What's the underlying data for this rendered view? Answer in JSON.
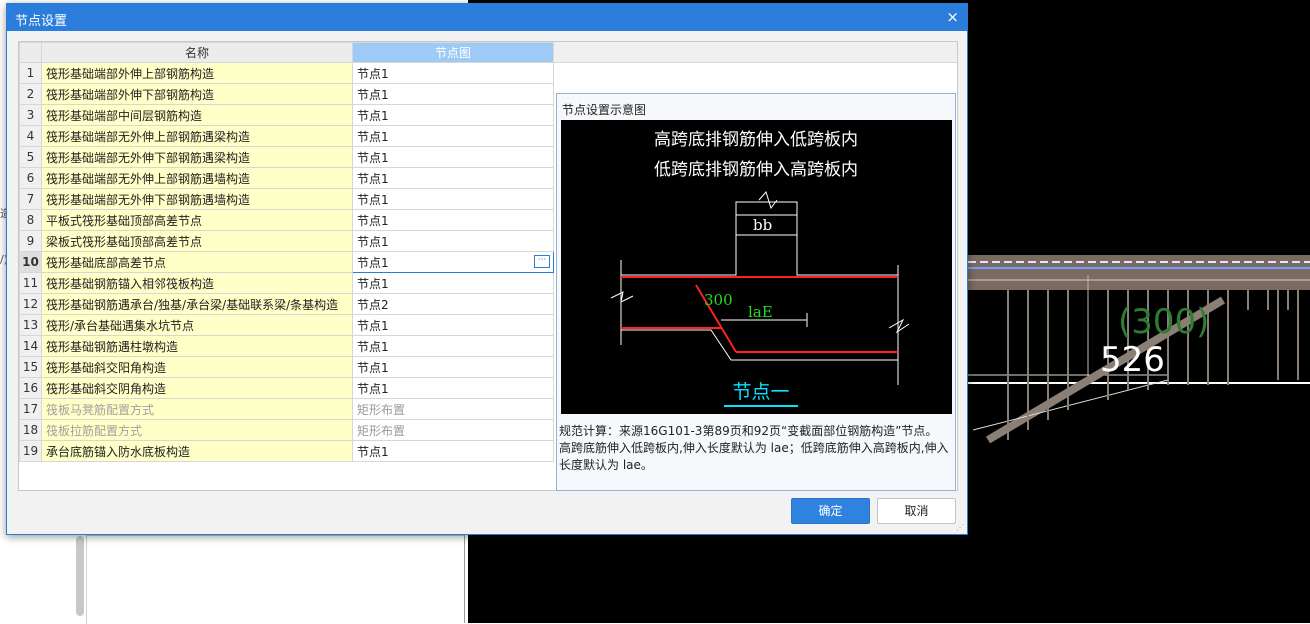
{
  "dialog": {
    "title": "节点设置",
    "close_label": "×",
    "ok_label": "确定",
    "cancel_label": "取消"
  },
  "table": {
    "columns": [
      "名称",
      "节点图"
    ],
    "rows": [
      {
        "num": "1",
        "name": "筏形基础端部外伸上部钢筋构造",
        "node": "节点1"
      },
      {
        "num": "2",
        "name": "筏形基础端部外伸下部钢筋构造",
        "node": "节点1"
      },
      {
        "num": "3",
        "name": "筏形基础端部中间层钢筋构造",
        "node": "节点1"
      },
      {
        "num": "4",
        "name": "筏形基础端部无外伸上部钢筋遇梁构造",
        "node": "节点1"
      },
      {
        "num": "5",
        "name": "筏形基础端部无外伸下部钢筋遇梁构造",
        "node": "节点1"
      },
      {
        "num": "6",
        "name": "筏形基础端部无外伸上部钢筋遇墙构造",
        "node": "节点1"
      },
      {
        "num": "7",
        "name": "筏形基础端部无外伸下部钢筋遇墙构造",
        "node": "节点1"
      },
      {
        "num": "8",
        "name": "平板式筏形基础顶部高差节点",
        "node": "节点1"
      },
      {
        "num": "9",
        "name": "梁板式筏形基础顶部高差节点",
        "node": "节点1"
      },
      {
        "num": "10",
        "name": "筏形基础底部高差节点",
        "node": "节点1"
      },
      {
        "num": "11",
        "name": "筏形基础钢筋锚入相邻筏板构造",
        "node": "节点1"
      },
      {
        "num": "12",
        "name": "筏形基础钢筋遇承台/独基/承台梁/基础联系梁/条基构造",
        "node": "节点2"
      },
      {
        "num": "13",
        "name": "筏形/承台基础遇集水坑节点",
        "node": "节点1"
      },
      {
        "num": "14",
        "name": "筏形基础钢筋遇柱墩构造",
        "node": "节点1"
      },
      {
        "num": "15",
        "name": "筏形基础斜交阳角构造",
        "node": "节点1"
      },
      {
        "num": "16",
        "name": "筏形基础斜交阴角构造",
        "node": "节点1"
      },
      {
        "num": "17",
        "name": "筏板马凳筋配置方式",
        "node": "矩形布置"
      },
      {
        "num": "18",
        "name": "筏板拉筋配置方式",
        "node": "矩形布置"
      },
      {
        "num": "19",
        "name": "承台底筋锚入防水底板构造",
        "node": "节点1"
      }
    ],
    "selected_row": "10",
    "disabled_rows": [
      "17",
      "18"
    ]
  },
  "preview": {
    "title": "节点设置示意图",
    "diagram_line1": "高跨底排钢筋伸入低跨板内",
    "diagram_line2": "低跨底排钢筋伸入高跨板内",
    "label_bb": "bb",
    "label_300": "300",
    "label_lae": "laE",
    "label_node": "节点一",
    "description": "规范计算：来源16G101-3第89页和92页“变截面部位钢筋构造”节点。\n高跨底筋伸入低跨板内,伸入长度默认为 lae；低跨底筋伸入高跨板内,伸入长度默认为 lae。"
  },
  "background": {
    "hint1": "造(",
    "hint2": "/)",
    "cad_label_1": "(300)",
    "cad_label_2": "526"
  },
  "colors": {
    "title_bar": "#2b7ddb",
    "name_cell": "#ffffc8",
    "active_header": "#9ecbf5",
    "rebar_red": "#ff2020",
    "diagram_green": "#22dd22",
    "diagram_cyan": "#00e5ff"
  }
}
